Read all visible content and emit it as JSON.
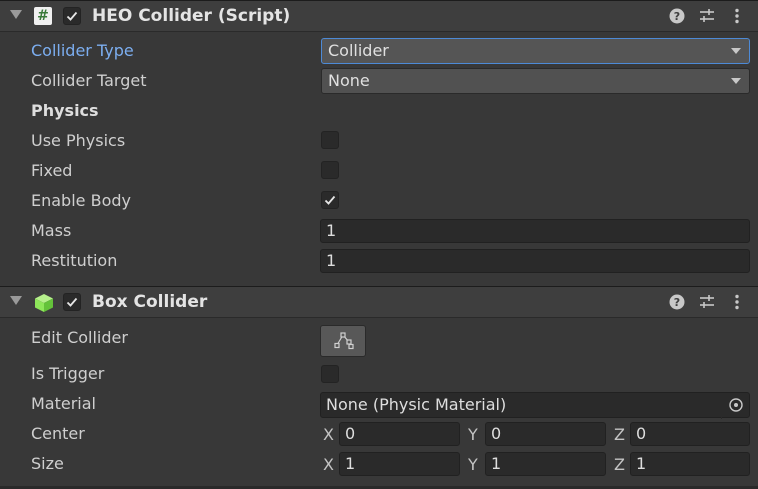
{
  "heo_collider": {
    "title": "HEO Collider (Script)",
    "icon": "#",
    "enabled": true,
    "collider_type": {
      "label": "Collider Type",
      "value": "Collider"
    },
    "collider_target": {
      "label": "Collider Target",
      "value": "None"
    },
    "physics_heading": "Physics",
    "use_physics": {
      "label": "Use Physics",
      "checked": false
    },
    "fixed": {
      "label": "Fixed",
      "checked": false
    },
    "enable_body": {
      "label": "Enable Body",
      "checked": true
    },
    "mass": {
      "label": "Mass",
      "value": "1"
    },
    "restitution": {
      "label": "Restitution",
      "value": "1"
    }
  },
  "box_collider": {
    "title": "Box Collider",
    "enabled": true,
    "edit_collider": {
      "label": "Edit Collider"
    },
    "is_trigger": {
      "label": "Is Trigger",
      "checked": false
    },
    "material": {
      "label": "Material",
      "value": "None (Physic Material)"
    },
    "center": {
      "label": "Center",
      "x_label": "X",
      "y_label": "Y",
      "z_label": "Z",
      "x": "0",
      "y": "0",
      "z": "0"
    },
    "size": {
      "label": "Size",
      "x_label": "X",
      "y_label": "Y",
      "z_label": "Z",
      "x": "1",
      "y": "1",
      "z": "1"
    }
  },
  "icons": {
    "help": "help-icon",
    "presets": "presets-icon",
    "menu": "more-menu-icon",
    "cube": "box-collider-icon",
    "edit": "edit-collider-icon",
    "picker": "object-picker-icon"
  },
  "colors": {
    "background": "#383838",
    "header": "#3e3e3e",
    "active_label": "#7caef0",
    "focus_border": "#4d8ad6",
    "cube_green": "#8ee65a"
  }
}
